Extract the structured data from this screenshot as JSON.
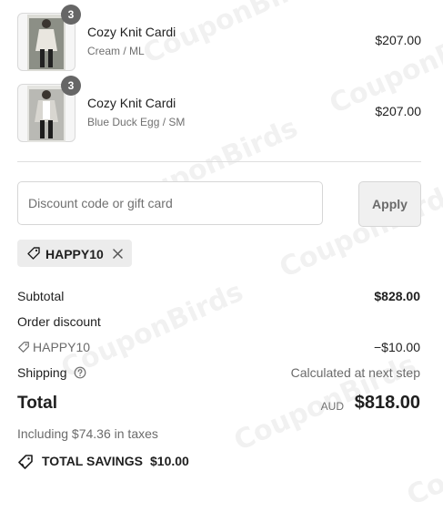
{
  "watermark": "CouponBirds",
  "items": [
    {
      "title": "Cozy Knit Cardi",
      "variant": "Cream / ML",
      "price": "$207.00",
      "quantity": "3"
    },
    {
      "title": "Cozy Knit Cardi",
      "variant": "Blue Duck Egg / SM",
      "price": "$207.00",
      "quantity": "3"
    }
  ],
  "discount": {
    "placeholder": "Discount code or gift card",
    "value": "",
    "apply_label": "Apply"
  },
  "applied_code": {
    "code": "HAPPY10",
    "icon": "tag-icon",
    "remove_icon": "close-icon"
  },
  "summary": {
    "subtotal_label": "Subtotal",
    "subtotal_value": "$828.00",
    "order_discount_label": "Order discount",
    "discount_code": "HAPPY10",
    "discount_value": "−$10.00",
    "shipping_label": "Shipping",
    "shipping_value": "Calculated at next step",
    "total_label": "Total",
    "currency": "AUD",
    "total_value": "$818.00",
    "taxes_note": "Including $74.36 in taxes",
    "savings_label": "TOTAL SAVINGS",
    "savings_value": "$10.00"
  },
  "colors": {
    "accent": "#1f1f1f",
    "muted": "#707070",
    "border": "#d6d6d6",
    "chip": "#ececec",
    "badge": "#666666"
  }
}
